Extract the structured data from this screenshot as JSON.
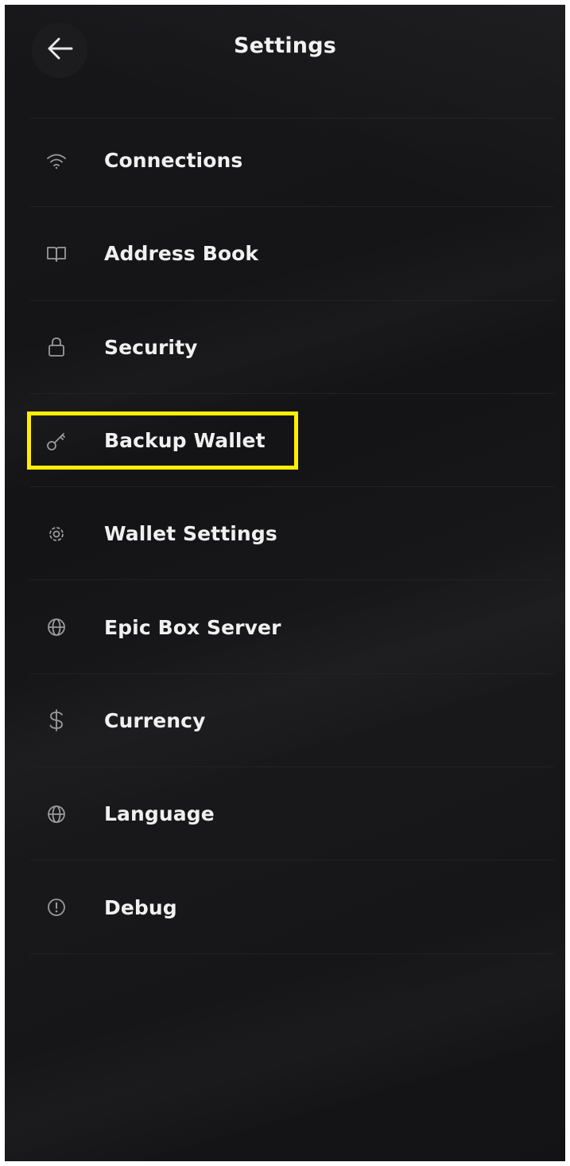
{
  "header": {
    "title": "Settings",
    "back_icon": "arrow-left-icon"
  },
  "menu": {
    "items": [
      {
        "label": "Connections",
        "icon": "wifi-icon"
      },
      {
        "label": "Address Book",
        "icon": "book-icon"
      },
      {
        "label": "Security",
        "icon": "lock-icon"
      },
      {
        "label": "Backup Wallet",
        "icon": "key-icon"
      },
      {
        "label": "Wallet Settings",
        "icon": "gear-icon"
      },
      {
        "label": "Epic Box Server",
        "icon": "globe-icon"
      },
      {
        "label": "Currency",
        "icon": "dollar-icon"
      },
      {
        "label": "Language",
        "icon": "globe-icon"
      },
      {
        "label": "Debug",
        "icon": "alert-circle-icon"
      }
    ]
  },
  "colors": {
    "background": "#151517",
    "text": "#f0f0f0",
    "icon": "#9a9a9e",
    "divider": "#222225",
    "highlight": "#ffee00"
  }
}
